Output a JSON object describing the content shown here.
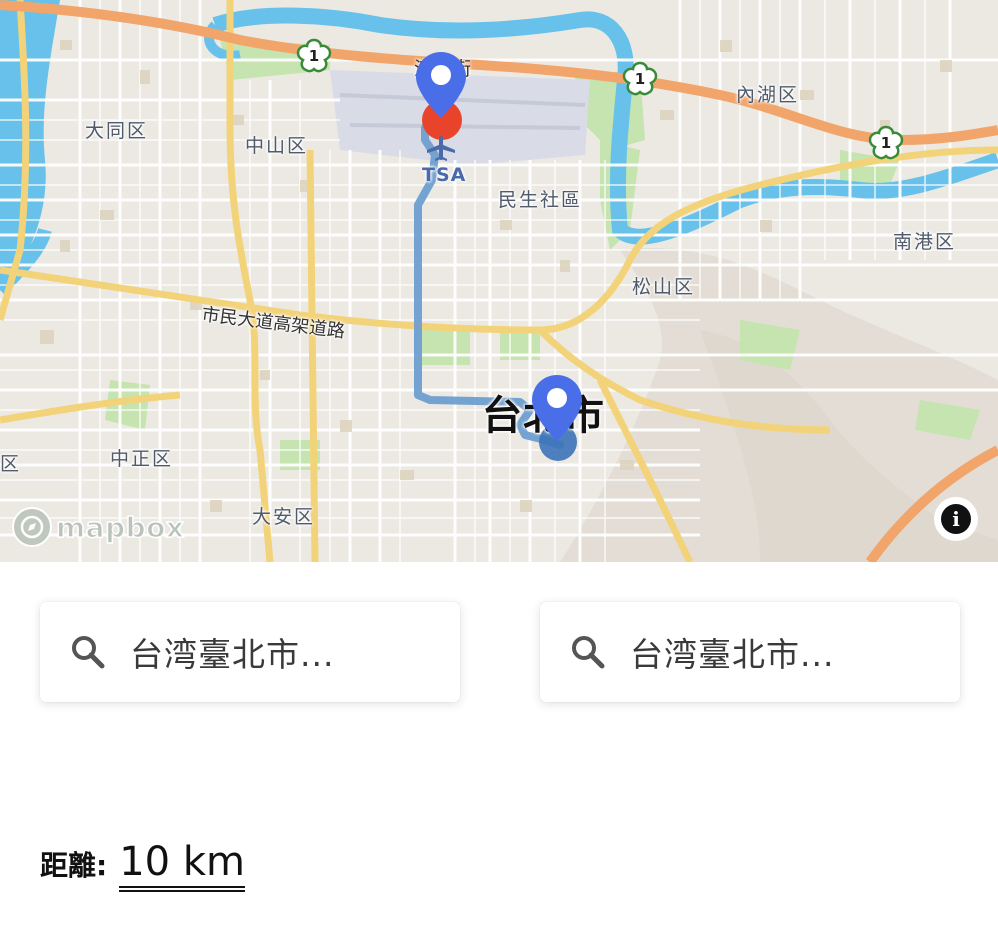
{
  "map": {
    "labels": {
      "datong": "大同区",
      "zhongshan": "中山区",
      "minsheng": "民生社區",
      "neihu": "內湖区",
      "nangang": "南港区",
      "songshan": "松山区",
      "zhongzheng": "中正区",
      "daan": "大安区",
      "partial_left": "区",
      "street_top": "濱江街",
      "airport": "TSA",
      "city": "台北市",
      "elevated_road": "市民大道高架道路"
    },
    "route_shield": "1",
    "brand": "mapbox",
    "info_button": "i",
    "colors": {
      "route": "#6f9fd0",
      "pin": "#4a6ee8",
      "origin_marker": "#e8442c",
      "destination_marker": "#3c72b8",
      "highway": "#f0a46a",
      "major_road": "#f0cf6a",
      "water": "#67c1ea",
      "park": "#bfe3a8"
    }
  },
  "search": {
    "origin": {
      "icon": "search-icon",
      "value": "台湾臺北市..."
    },
    "destination": {
      "icon": "search-icon",
      "value": "台湾臺北市..."
    }
  },
  "distance": {
    "label": "距離:",
    "value": "10 km"
  }
}
